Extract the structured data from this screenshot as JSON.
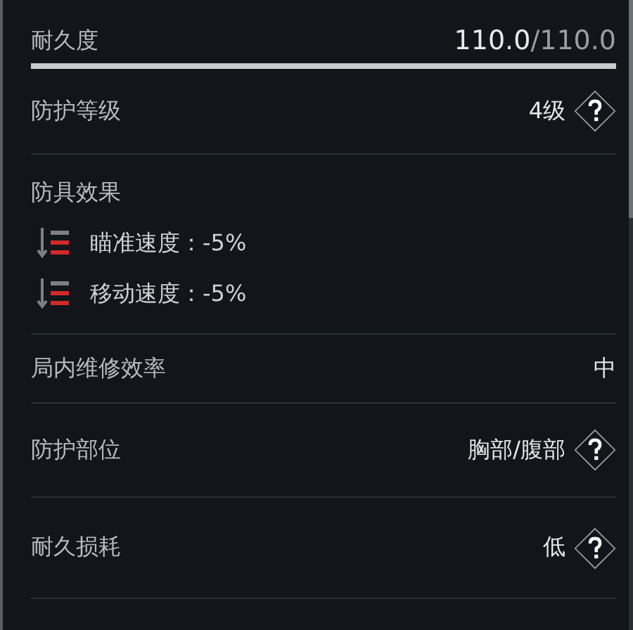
{
  "durability": {
    "label": "耐久度",
    "current": "110.0",
    "max": "/110.0",
    "level": 1.0
  },
  "stats": [
    {
      "kind": "stat",
      "label": "防护等级",
      "value": "4级",
      "help": true
    },
    {
      "kind": "effects",
      "label": "防具效果",
      "effects": [
        {
          "text": "瞄准速度：-5%"
        },
        {
          "text": "移动速度：-5%"
        }
      ]
    },
    {
      "kind": "stat",
      "label": "局内维修效率",
      "value": "中",
      "help": false
    },
    {
      "kind": "stat",
      "label": "防护部位",
      "value": "胸部/腹部",
      "help": true
    },
    {
      "kind": "stat",
      "label": "耐久损耗",
      "value": "低",
      "help": true
    }
  ]
}
